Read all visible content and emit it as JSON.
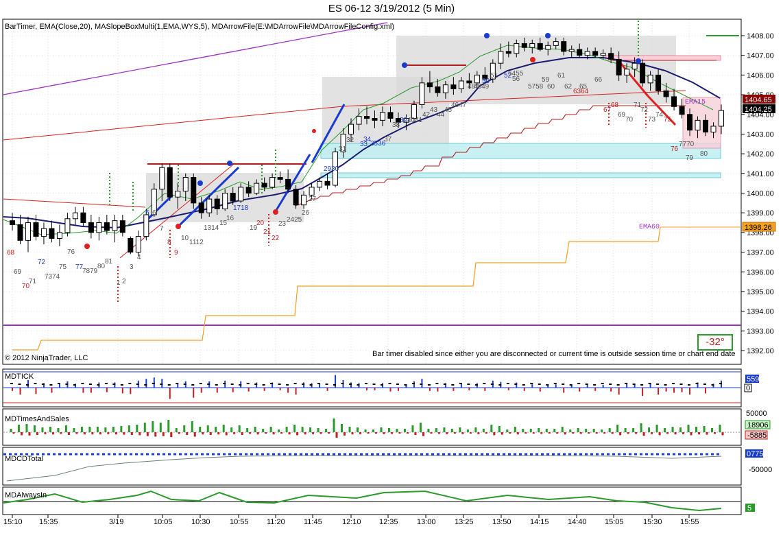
{
  "window": {
    "title": "ES 06-12  3/19/2012 (5 Min)"
  },
  "indicators_line": "BarTimer, EMA(Close,20), MASlopeBoxMulti(1,EMA,WYS,5), MDArrowFile(E:\\MDArrowFile\\MDArrowFileConfig.xml)",
  "copyright": "© 2012 NinjaTrader, LLC",
  "bar_timer_message": "Bar timer disabled since either you are disconnected or current time is outside session time or chart end date",
  "slope_box": "-32°",
  "ema_labels": {
    "ema15": "EMA15",
    "ema60": "EMA60"
  },
  "price_markers": [
    {
      "value": "1404.65",
      "bg": "#8b0000",
      "fg": "#ffffff"
    },
    {
      "value": "1404.25",
      "bg": "#000000",
      "fg": "#ffffff"
    },
    {
      "value": "1398.26",
      "bg": "#f4a020",
      "fg": "#000000"
    }
  ],
  "colors": {
    "up_bar": "#ffffff",
    "down_bar": "#000000",
    "ema": "#1c1c6e",
    "ema_green": "#2a9a2a",
    "step_red": "#b01c1c",
    "step_orange": "#f0a020",
    "purple": "#9a2fc0",
    "box_gray": "#d8d8d8",
    "box_cyan": "#c4f0f2",
    "box_pink": "#f7d0d8",
    "arrow_blue": "#1a3bd0",
    "arrow_red": "#e02020"
  },
  "panels": {
    "price": {
      "label": ""
    },
    "mdtick": {
      "label": "MDTICK",
      "value": "559",
      "zero": "0"
    },
    "mdtimesandsales": {
      "label": "MDTimesAndSales",
      "top": "50000",
      "value_pos": "18906",
      "value_neg": "-5885"
    },
    "mdcdtotal": {
      "label": "MDCDTotal",
      "value": "0775",
      "tick": "-50000"
    },
    "mdalwaysin": {
      "label": "MDAlwaysIn",
      "value": "5"
    }
  },
  "chart_data": {
    "type": "candlestick",
    "title": "ES 06-12  3/19/2012 (5 Min)",
    "ylim": [
      1391.6,
      1408.6
    ],
    "y_ticks": [
      1392,
      1393,
      1394,
      1395,
      1396,
      1397,
      1398,
      1399,
      1400,
      1401,
      1402,
      1403,
      1404,
      1405,
      1406,
      1407,
      1408
    ],
    "x_tick_labels": [
      "15:10",
      "15:35",
      "3/19",
      "10:05",
      "10:30",
      "10:55",
      "11:20",
      "11:45",
      "12:10",
      "12:35",
      "13:00",
      "13:25",
      "13:50",
      "14:15",
      "14:40",
      "15:05",
      "15:30",
      "15:55"
    ],
    "bar_labels": [
      "68",
      "69",
      "70",
      "71",
      "7374",
      "72",
      "75",
      "76",
      "77",
      "7879",
      "80",
      "81",
      "1",
      "2",
      "3",
      "4",
      "5",
      "6",
      "7",
      "8",
      "9",
      "10",
      "1112",
      "1314",
      "15",
      "16",
      "1718",
      "19",
      "20",
      "21",
      "22",
      "23",
      "2425",
      "26",
      "27",
      "2930",
      "31",
      "32",
      "33",
      "34",
      "3536",
      "37",
      "38",
      "39",
      "4041",
      "42",
      "43",
      "44",
      "45",
      "4647",
      "48",
      "4849",
      "50",
      "51",
      "52",
      "5455",
      "56",
      "5758",
      "59",
      "60",
      "61",
      "62",
      "6364",
      "65",
      "66",
      "67",
      "68",
      "69",
      "70",
      "71",
      "72",
      "73",
      "74",
      "75",
      "76",
      "7770",
      "79",
      "80"
    ],
    "ohlc": [
      [
        1398.6,
        1399.0,
        1398.1,
        1398.4
      ],
      [
        1398.4,
        1398.9,
        1397.4,
        1397.6
      ],
      [
        1397.6,
        1398.8,
        1397.0,
        1398.5
      ],
      [
        1398.5,
        1398.9,
        1397.6,
        1397.8
      ],
      [
        1397.8,
        1398.5,
        1397.4,
        1398.2
      ],
      [
        1398.2,
        1398.6,
        1397.5,
        1397.7
      ],
      [
        1397.7,
        1398.4,
        1397.3,
        1398.0
      ],
      [
        1398.0,
        1399.0,
        1397.8,
        1398.7
      ],
      [
        1398.7,
        1399.3,
        1398.4,
        1399.0
      ],
      [
        1399.0,
        1399.3,
        1398.3,
        1398.5
      ],
      [
        1398.5,
        1398.9,
        1397.7,
        1398.0
      ],
      [
        1398.0,
        1398.8,
        1397.6,
        1398.5
      ],
      [
        1398.5,
        1398.9,
        1397.9,
        1398.1
      ],
      [
        1398.1,
        1398.9,
        1397.5,
        1398.6
      ],
      [
        1398.6,
        1398.9,
        1397.8,
        1398.0
      ],
      [
        1397.7,
        1397.8,
        1396.9,
        1397.0
      ],
      [
        1397.0,
        1398.1,
        1396.8,
        1397.8
      ],
      [
        1397.8,
        1399.2,
        1397.6,
        1398.9
      ],
      [
        1398.9,
        1400.5,
        1398.8,
        1400.2
      ],
      [
        1400.2,
        1401.5,
        1399.6,
        1401.3
      ],
      [
        1401.3,
        1401.5,
        1399.6,
        1399.8
      ],
      [
        1399.8,
        1400.5,
        1399.2,
        1400.1
      ],
      [
        1400.1,
        1401.0,
        1399.6,
        1400.8
      ],
      [
        1400.8,
        1401.0,
        1399.2,
        1399.5
      ],
      [
        1399.5,
        1399.8,
        1398.7,
        1399.0
      ],
      [
        1399.0,
        1399.9,
        1398.8,
        1399.7
      ],
      [
        1399.7,
        1399.9,
        1398.9,
        1399.2
      ],
      [
        1399.2,
        1400.2,
        1399.1,
        1400.0
      ],
      [
        1400.0,
        1400.3,
        1399.4,
        1399.6
      ],
      [
        1399.6,
        1400.5,
        1399.5,
        1400.3
      ],
      [
        1400.3,
        1400.6,
        1399.8,
        1400.0
      ],
      [
        1400.0,
        1400.7,
        1399.9,
        1400.5
      ],
      [
        1400.5,
        1400.8,
        1400.1,
        1400.3
      ],
      [
        1400.3,
        1401.0,
        1400.2,
        1400.8
      ],
      [
        1400.8,
        1401.1,
        1400.5,
        1400.7
      ],
      [
        1400.7,
        1401.2,
        1400.0,
        1400.2
      ],
      [
        1400.2,
        1400.4,
        1399.2,
        1399.4
      ],
      [
        1399.4,
        1400.1,
        1399.2,
        1399.9
      ],
      [
        1399.9,
        1400.5,
        1399.7,
        1400.3
      ],
      [
        1400.3,
        1400.8,
        1400.1,
        1400.6
      ],
      [
        1400.6,
        1401.0,
        1400.2,
        1400.4
      ],
      [
        1400.4,
        1402.3,
        1400.3,
        1402.1
      ],
      [
        1402.1,
        1403.3,
        1401.8,
        1403.0
      ],
      [
        1403.0,
        1403.8,
        1402.6,
        1403.5
      ],
      [
        1403.5,
        1404.3,
        1403.2,
        1403.9
      ],
      [
        1403.9,
        1404.4,
        1403.5,
        1403.8
      ],
      [
        1403.8,
        1404.2,
        1403.3,
        1403.7
      ],
      [
        1403.7,
        1404.4,
        1403.4,
        1404.1
      ],
      [
        1404.1,
        1404.4,
        1403.6,
        1403.8
      ],
      [
        1403.8,
        1404.1,
        1403.3,
        1403.6
      ],
      [
        1403.6,
        1404.0,
        1403.2,
        1403.8
      ],
      [
        1403.8,
        1404.7,
        1403.6,
        1404.5
      ],
      [
        1404.5,
        1405.9,
        1404.3,
        1405.6
      ],
      [
        1405.6,
        1406.2,
        1405.1,
        1405.4
      ],
      [
        1405.4,
        1405.8,
        1404.9,
        1405.1
      ],
      [
        1405.1,
        1405.7,
        1404.8,
        1405.5
      ],
      [
        1405.5,
        1405.9,
        1405.0,
        1405.3
      ],
      [
        1405.3,
        1405.9,
        1405.1,
        1405.7
      ],
      [
        1405.7,
        1406.1,
        1405.3,
        1405.6
      ],
      [
        1405.6,
        1406.2,
        1405.4,
        1406.0
      ],
      [
        1406.0,
        1406.4,
        1405.6,
        1405.8
      ],
      [
        1405.8,
        1406.8,
        1405.6,
        1406.6
      ],
      [
        1406.6,
        1407.6,
        1406.3,
        1407.2
      ],
      [
        1407.2,
        1407.7,
        1406.9,
        1407.1
      ],
      [
        1407.1,
        1407.8,
        1406.9,
        1407.6
      ],
      [
        1407.6,
        1407.9,
        1407.2,
        1407.4
      ],
      [
        1407.4,
        1407.8,
        1407.1,
        1407.6
      ],
      [
        1407.6,
        1407.9,
        1407.2,
        1407.3
      ],
      [
        1407.3,
        1407.7,
        1407.0,
        1407.5
      ],
      [
        1407.5,
        1407.9,
        1407.3,
        1407.7
      ],
      [
        1407.7,
        1407.9,
        1407.0,
        1407.2
      ],
      [
        1407.2,
        1407.5,
        1406.9,
        1407.3
      ],
      [
        1407.3,
        1407.6,
        1406.9,
        1407.0
      ],
      [
        1407.0,
        1407.4,
        1406.8,
        1407.2
      ],
      [
        1407.2,
        1407.4,
        1406.9,
        1407.0
      ],
      [
        1407.0,
        1407.3,
        1406.8,
        1407.1
      ],
      [
        1407.1,
        1407.4,
        1406.6,
        1406.8
      ],
      [
        1406.8,
        1407.2,
        1405.7,
        1406.0
      ],
      [
        1406.0,
        1406.6,
        1405.6,
        1406.3
      ],
      [
        1406.3,
        1406.9,
        1405.9,
        1406.6
      ],
      [
        1406.6,
        1406.8,
        1405.4,
        1405.6
      ],
      [
        1405.6,
        1406.2,
        1405.2,
        1406.0
      ],
      [
        1406.0,
        1406.3,
        1405.0,
        1405.2
      ],
      [
        1405.2,
        1405.6,
        1404.6,
        1404.9
      ],
      [
        1404.9,
        1405.3,
        1404.2,
        1404.4
      ],
      [
        1404.4,
        1404.8,
        1403.8,
        1404.0
      ],
      [
        1404.0,
        1404.3,
        1402.9,
        1403.2
      ],
      [
        1403.2,
        1403.9,
        1402.8,
        1403.7
      ],
      [
        1403.7,
        1404.0,
        1402.9,
        1403.1
      ],
      [
        1403.1,
        1403.6,
        1402.8,
        1403.4
      ],
      [
        1403.4,
        1404.5,
        1403.0,
        1404.2
      ]
    ],
    "ema20": [
      1398.0,
      1398.0,
      1398.0,
      1398.0,
      1397.9,
      1397.9,
      1397.9,
      1397.9,
      1398.0,
      1398.0,
      1398.0,
      1398.0,
      1398.0,
      1398.0,
      1398.0,
      1397.9,
      1397.9,
      1398.0,
      1398.2,
      1398.4,
      1398.5,
      1398.6,
      1398.8,
      1398.8,
      1398.8,
      1398.9,
      1398.9,
      1399.0,
      1399.0,
      1399.1,
      1399.2,
      1399.3,
      1399.3,
      1399.5,
      1399.6,
      1399.6,
      1399.6,
      1399.6,
      1399.7,
      1399.8,
      1399.9,
      1400.1,
      1400.4,
      1400.7,
      1401.0,
      1401.2,
      1401.4,
      1401.7,
      1401.8,
      1402.0,
      1402.1,
      1402.3,
      1402.6,
      1402.8,
      1403.0,
      1403.2,
      1403.4,
      1403.6,
      1403.8,
      1404.0,
      1404.1,
      1404.3,
      1404.6,
      1404.9,
      1405.1,
      1405.3,
      1405.5,
      1405.7,
      1405.9,
      1406.0,
      1406.1,
      1406.2,
      1406.3,
      1406.4,
      1406.5,
      1406.5,
      1406.6,
      1406.6,
      1406.6,
      1406.6,
      1406.5,
      1406.5,
      1406.4,
      1406.2,
      1406.0,
      1405.8,
      1405.5,
      1405.3,
      1405.1,
      1404.9,
      1404.8
    ],
    "series": [
      {
        "name": "EMA15",
        "last": 1404.65
      },
      {
        "name": "EMA60",
        "last": 1398.26
      }
    ],
    "horizontal_lines": [
      1393.3
    ]
  }
}
